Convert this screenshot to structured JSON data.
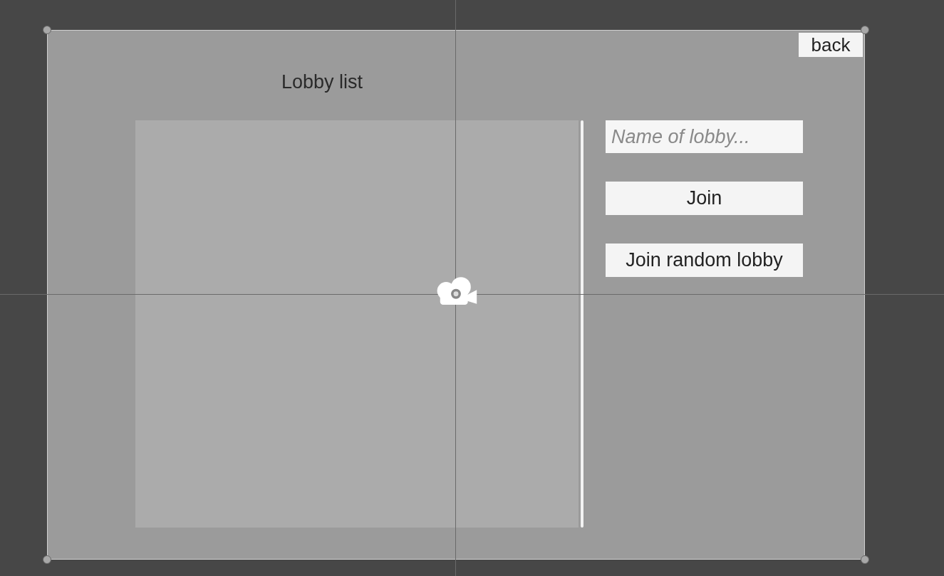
{
  "back_button": {
    "label": "back"
  },
  "title": "Lobby list",
  "lobby_name_field": {
    "placeholder": "Name of lobby..."
  },
  "buttons": [
    {
      "label": "Join"
    },
    {
      "label": "Join random lobby"
    }
  ]
}
